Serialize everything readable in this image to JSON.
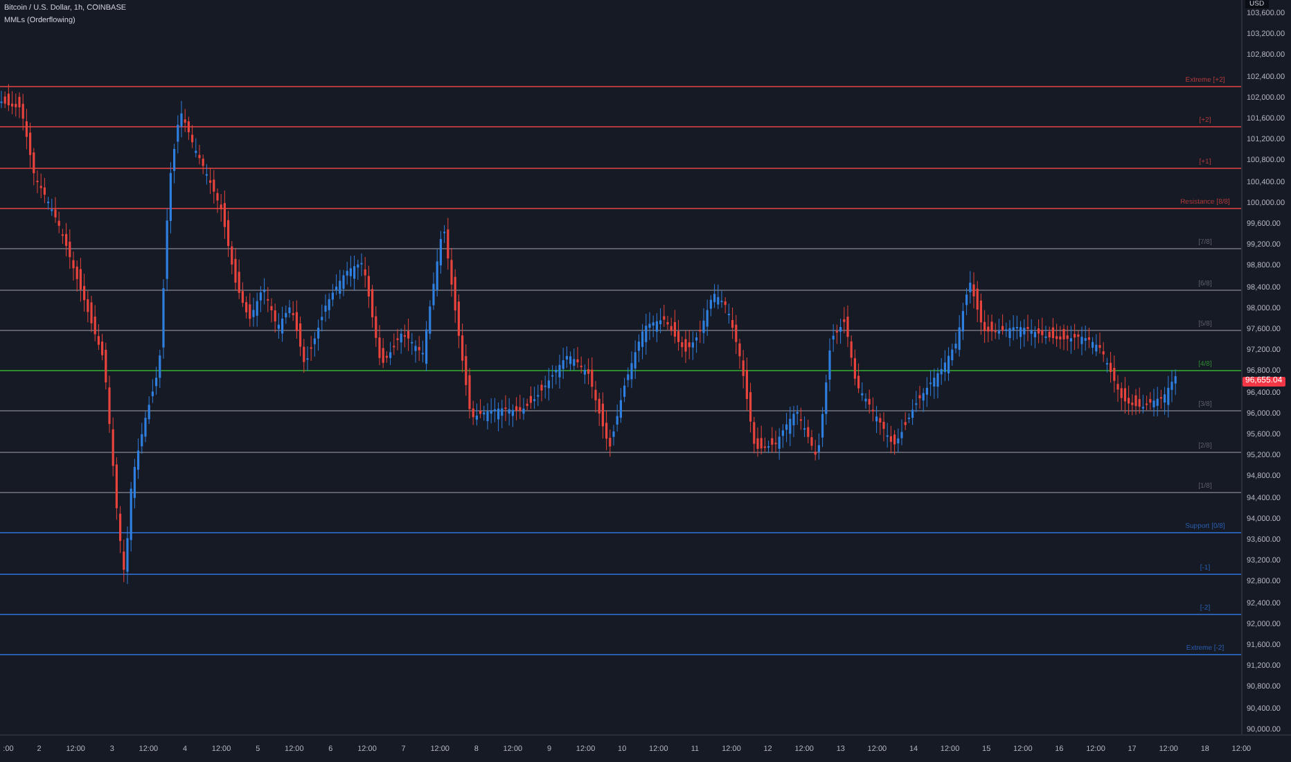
{
  "header": {
    "symbol": "Bitcoin / U.S. Dollar, 1h, COINBASE",
    "indicator": "MMLs (Orderflowing)"
  },
  "price_axis": {
    "currency": "USD",
    "labels": [
      "103,600.00",
      "103,200.00",
      "102,800.00",
      "102,400.00",
      "102,000.00",
      "101,600.00",
      "101,200.00",
      "100,800.00",
      "100,400.00",
      "100,000.00",
      "99,600.00",
      "99,200.00",
      "98,800.00",
      "98,400.00",
      "98,000.00",
      "97,600.00",
      "97,200.00",
      "96,800.00",
      "96,400.00",
      "96,000.00",
      "95,600.00",
      "95,200.00",
      "94,800.00",
      "94,400.00",
      "94,000.00",
      "93,600.00",
      "93,200.00",
      "92,800.00",
      "92,400.00",
      "92,000.00",
      "91,600.00",
      "91,200.00",
      "90,800.00",
      "90,400.00",
      "90,000.00"
    ],
    "current_price": "96,655.04"
  },
  "levels": [
    {
      "label": "Extreme [+2]",
      "color": "#b23a3a"
    },
    {
      "label": "[+2]",
      "color": "#b23a3a"
    },
    {
      "label": "[+1]",
      "color": "#b23a3a"
    },
    {
      "label": "Resistance [8/8]",
      "color": "#b23a3a"
    },
    {
      "label": "[7/8]",
      "color": "#5d606b"
    },
    {
      "label": "[6/8]",
      "color": "#5d606b"
    },
    {
      "label": "[5/8]",
      "color": "#5d606b"
    },
    {
      "label": "[4/8]",
      "color": "#2e8b2e"
    },
    {
      "label": "[3/8]",
      "color": "#5d606b"
    },
    {
      "label": "[2/8]",
      "color": "#5d606b"
    },
    {
      "label": "[1/8]",
      "color": "#5d606b"
    },
    {
      "label": "Support [0/8]",
      "color": "#2a5fb0"
    },
    {
      "label": "[-1]",
      "color": "#2a5fb0"
    },
    {
      "label": "[-2]",
      "color": "#2a5fb0"
    },
    {
      "label": "Extreme [-2]",
      "color": "#2a5fb0"
    }
  ],
  "time_axis": [
    ":00",
    "2",
    "12:00",
    "3",
    "12:00",
    "4",
    "12:00",
    "5",
    "12:00",
    "6",
    "12:00",
    "7",
    "12:00",
    "8",
    "12:00",
    "9",
    "12:00",
    "10",
    "12:00",
    "11",
    "12:00",
    "12",
    "12:00",
    "13",
    "12:00",
    "14",
    "12:00",
    "15",
    "12:00",
    "16",
    "12:00",
    "17",
    "12:00",
    "18",
    "12:00"
  ]
}
